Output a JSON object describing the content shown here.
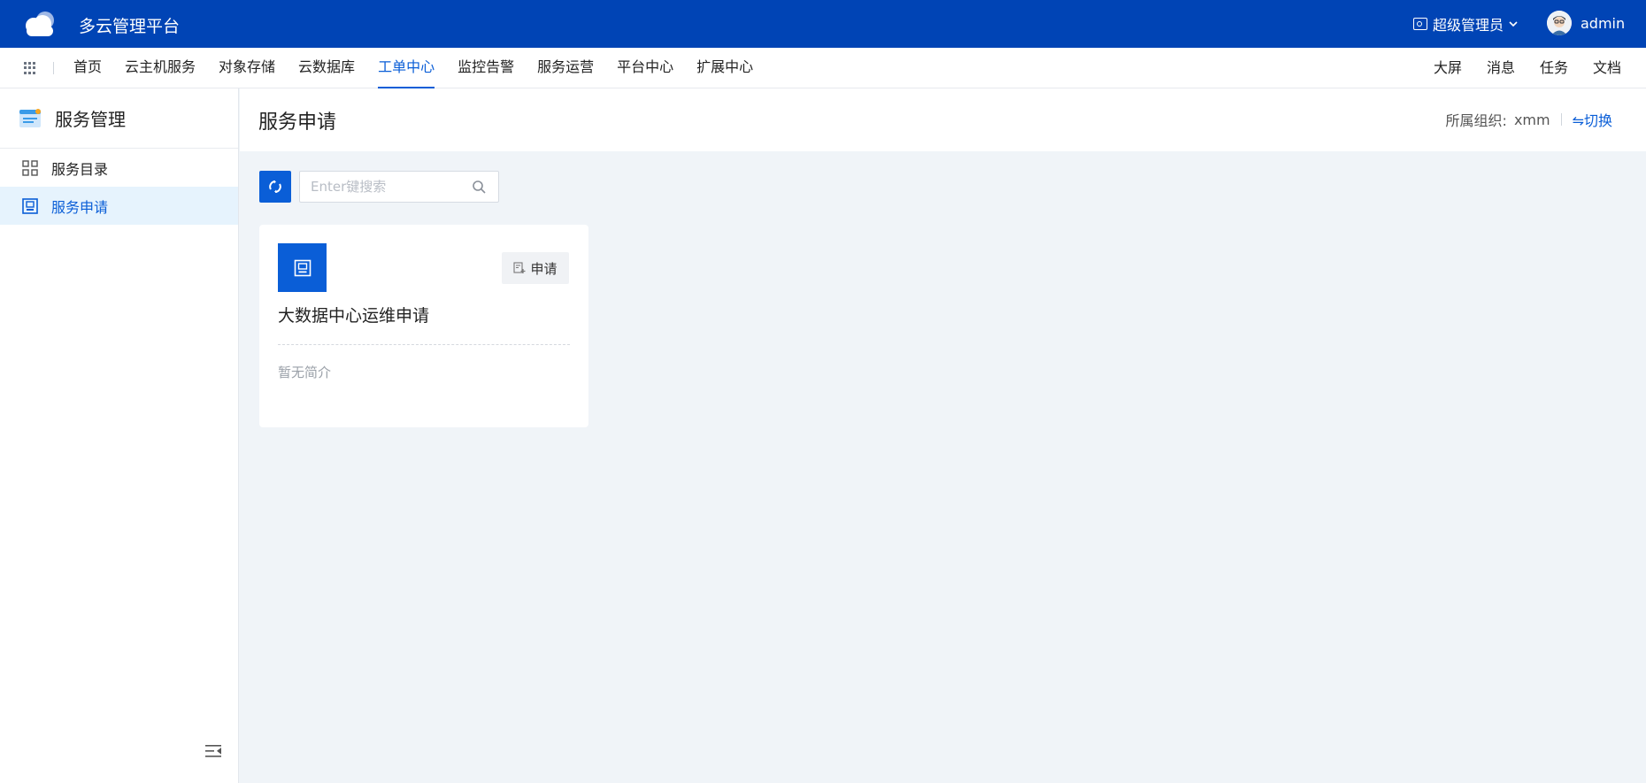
{
  "header": {
    "app_title": "多云管理平台",
    "role": "超级管理员",
    "username": "admin"
  },
  "menu": {
    "items": [
      "首页",
      "云主机服务",
      "对象存储",
      "云数据库",
      "工单中心",
      "监控告警",
      "服务运营",
      "平台中心",
      "扩展中心"
    ],
    "active_index": 4,
    "right_items": [
      "大屏",
      "消息",
      "任务",
      "文档"
    ]
  },
  "sidebar": {
    "title": "服务管理",
    "items": [
      {
        "label": "服务目录",
        "icon": "grid-icon",
        "active": false
      },
      {
        "label": "服务申请",
        "icon": "form-icon",
        "active": true
      }
    ]
  },
  "page": {
    "title": "服务申请",
    "org_label": "所属组织:",
    "org_value": "xmm",
    "switch_label": "⇋切换"
  },
  "search": {
    "placeholder": "Enter键搜索"
  },
  "cards": [
    {
      "title": "大数据中心运维申请",
      "description": "暂无简介",
      "apply_label": "申请"
    }
  ],
  "colors": {
    "header_bg": "#0044b5",
    "accent": "#0a5ed7",
    "active_bg": "#e6f3fd",
    "content_bg": "#f0f4f8"
  }
}
